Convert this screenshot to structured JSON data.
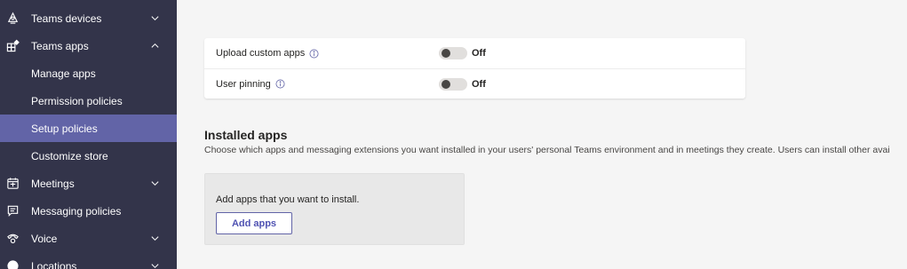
{
  "sidebar": {
    "items": [
      {
        "label": "Teams devices",
        "icon": "teams-devices-icon",
        "chevron": "down"
      },
      {
        "label": "Teams apps",
        "icon": "teams-apps-icon",
        "chevron": "up"
      },
      {
        "label": "Manage apps"
      },
      {
        "label": "Permission policies"
      },
      {
        "label": "Setup policies",
        "active": true
      },
      {
        "label": "Customize store"
      },
      {
        "label": "Meetings",
        "icon": "meetings-icon",
        "chevron": "down"
      },
      {
        "label": "Messaging policies",
        "icon": "messaging-policies-icon"
      },
      {
        "label": "Voice",
        "icon": "voice-icon",
        "chevron": "down"
      },
      {
        "label": "Locations",
        "icon": "locations-icon",
        "chevron": "down"
      }
    ]
  },
  "settings": [
    {
      "label": "Upload custom apps",
      "state": "Off"
    },
    {
      "label": "User pinning",
      "state": "Off"
    }
  ],
  "installed": {
    "title": "Installed apps",
    "description": "Choose which apps and messaging extensions you want installed in your users' personal Teams environment and in meetings they create. Users can install other avai",
    "empty_text": "Add apps that you want to install.",
    "add_button": "Add apps"
  },
  "colors": {
    "sidebar_bg": "#33344a",
    "active_bg": "#6264a7",
    "accent": "#6264a7"
  }
}
